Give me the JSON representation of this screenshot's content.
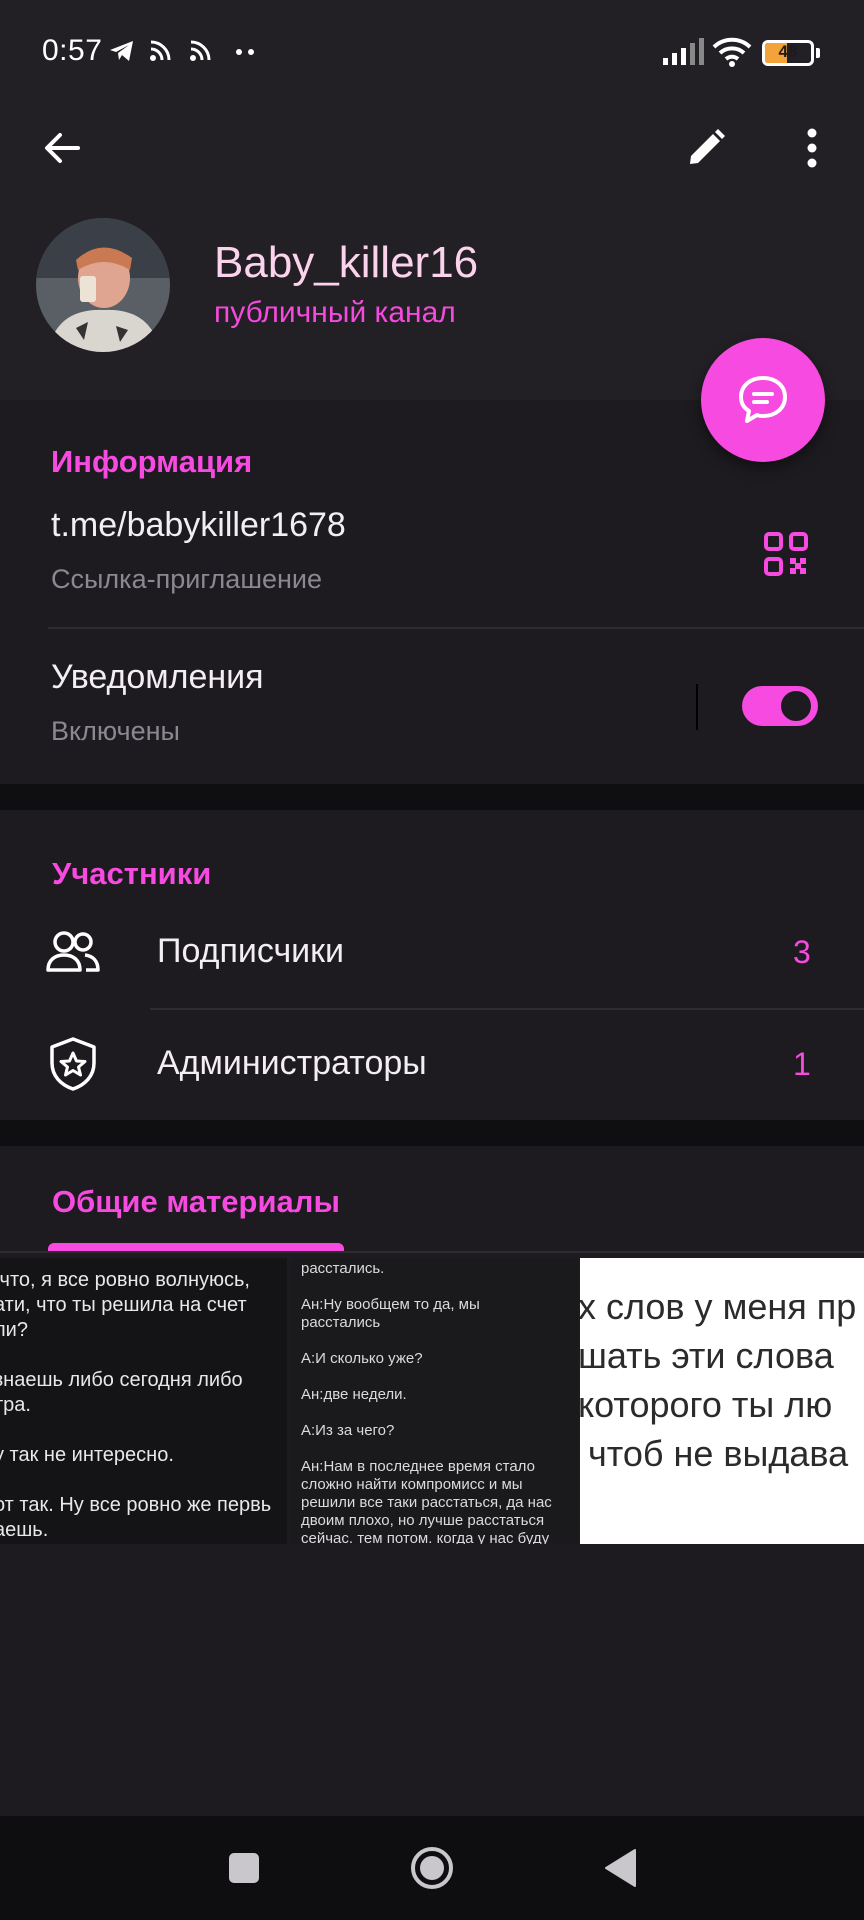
{
  "status_bar": {
    "time": "0:57",
    "battery": "48",
    "battery_level_percent": 48,
    "icons": [
      "telegram-icon",
      "rss-icon",
      "rss-icon",
      "more-dots-icon",
      "signal-icon",
      "wifi-icon",
      "battery-icon"
    ]
  },
  "header": {
    "channel_name": "Baby_killer16",
    "channel_type": "публичный канал"
  },
  "info": {
    "title": "Информация",
    "link": "t.me/babykiller1678",
    "link_caption": "Ссылка-приглашение",
    "notifications_label": "Уведомления",
    "notifications_state": "Включены",
    "notifications_on": true
  },
  "members": {
    "title": "Участники",
    "subscribers_label": "Подписчики",
    "subscribers_count": "3",
    "admins_label": "Администраторы",
    "admins_count": "1"
  },
  "media": {
    "tab_label": "Общие материалы",
    "tiles": [
      {
        "text": " что, я все ровно волнуюсь,\nати, что ты решила на счет\nли?\n\nзнаешь либо сегодня либо\nтра.\n\nу так не интересно.\n\nот так. Ну все ровно же первь\nаешь."
      },
      {
        "text": "расстались.\n\nАн:Ну вообщем то да, мы\nрасстались\n\nА:И сколько уже?\n\nАн:две недели.\n\nА:Из за чего?\n\nАн:Нам в последнее время стало\nсложно найти компромисс и мы\nрешили все таки расстаться, да нас\nдвоим плохо, но лучше расстаться\nсейчас. тем потом. когда у нас буду"
      },
      {
        "text": "х слов у меня пр\nшать эти слова\nкоторого ты лю\n чтоб не выдава"
      }
    ]
  },
  "colors": {
    "accent": "#f64ae0",
    "name_color": "#fbd3ec",
    "background": "#1d1b1f"
  }
}
